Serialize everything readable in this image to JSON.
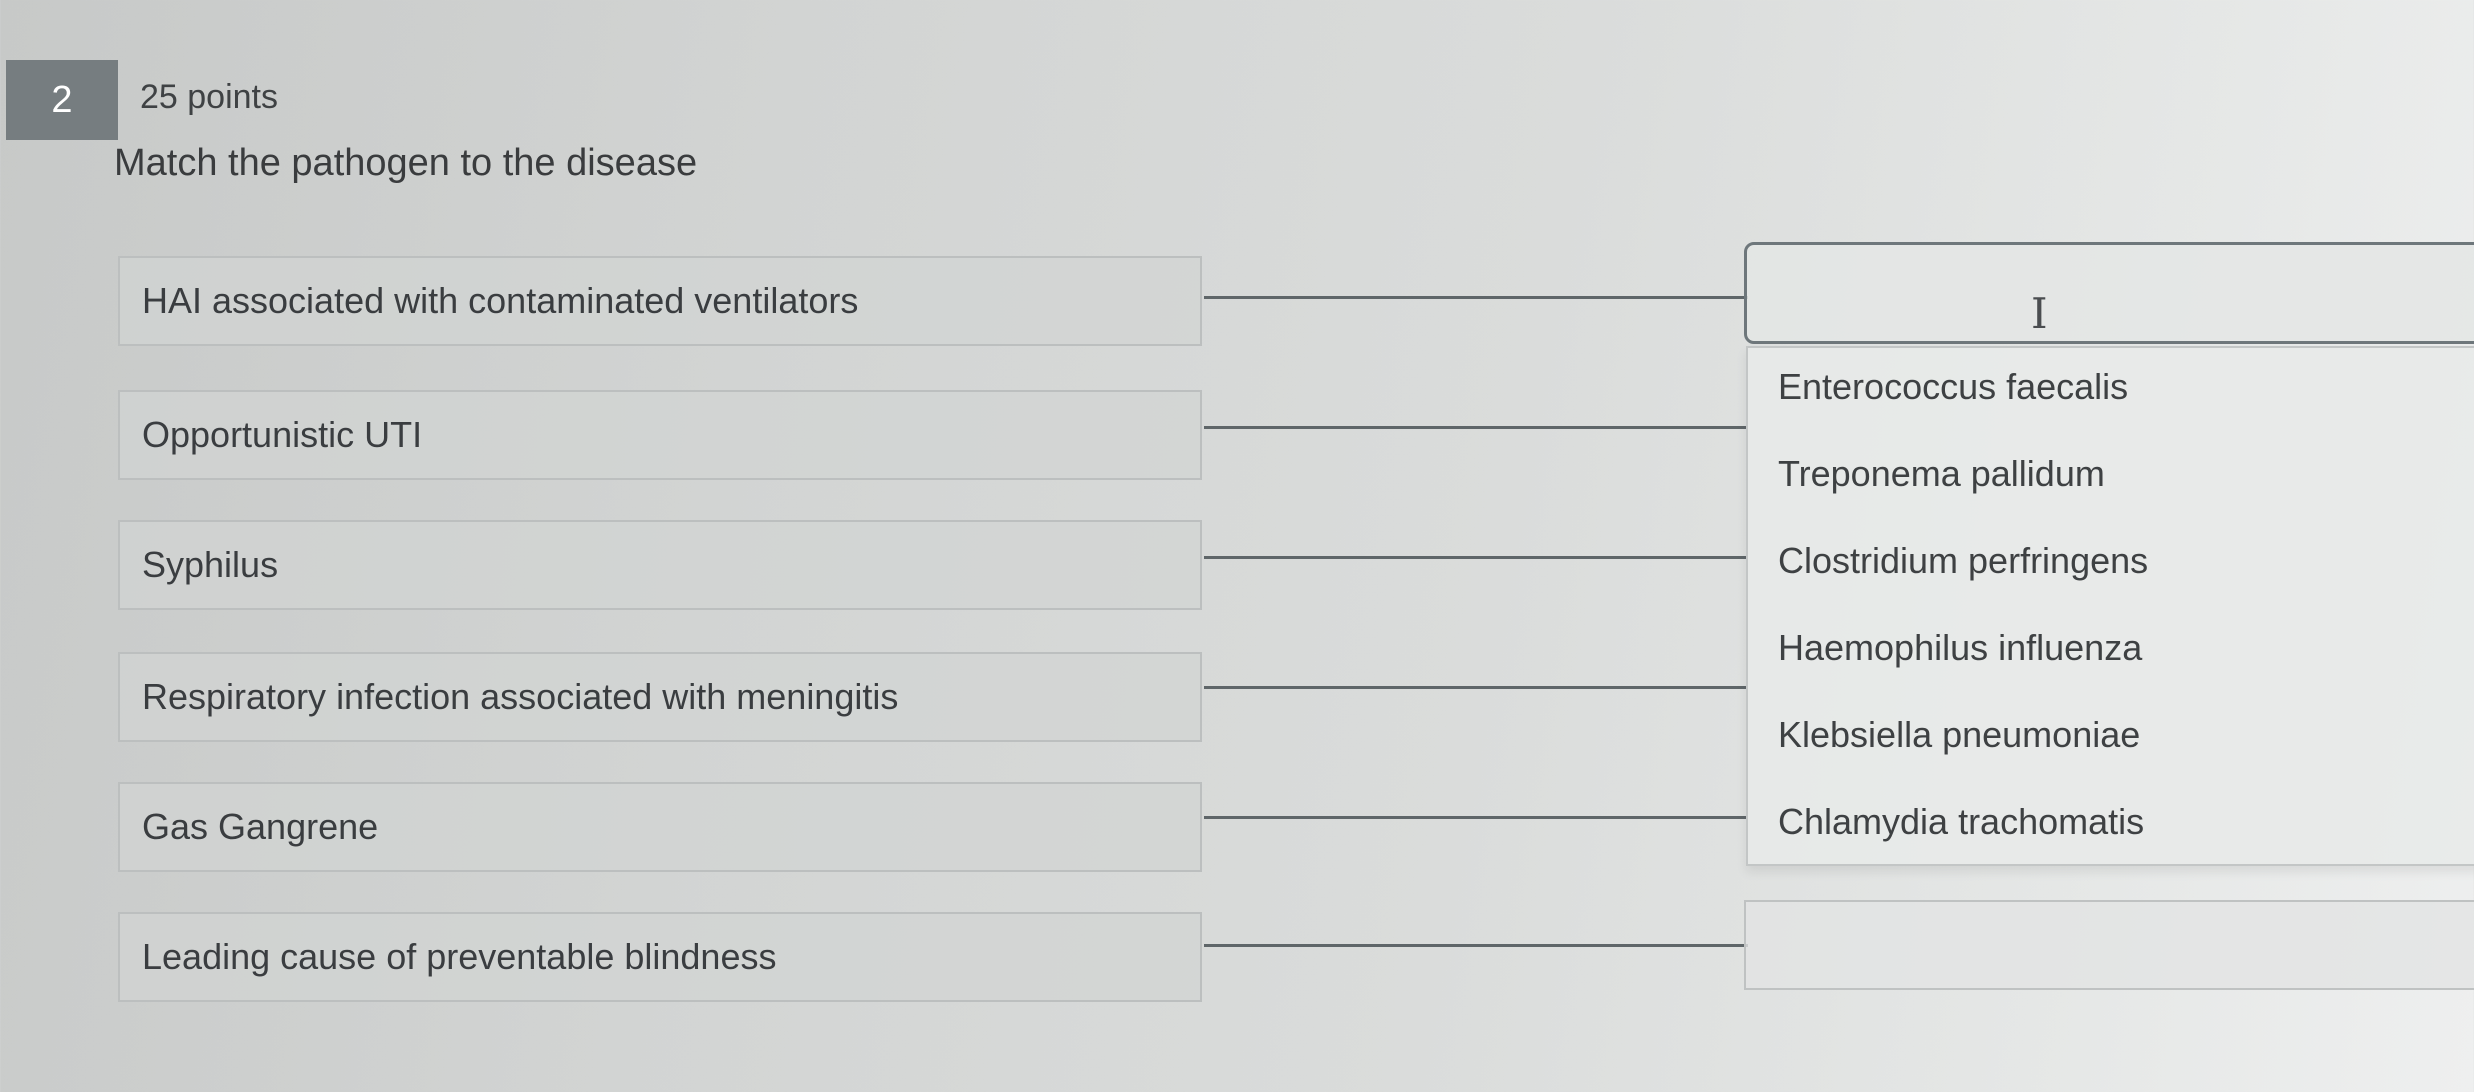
{
  "question": {
    "number": "2",
    "points": "25 points",
    "title": "Match the pathogen to the disease"
  },
  "prompts": [
    "HAI associated with contaminated ventilators",
    "Opportunistic UTI",
    "Syphilus",
    "Respiratory infection associated with meningitis",
    "Gas Gangrene",
    "Leading cause of preventable blindness"
  ],
  "dropdown": {
    "options": [
      "Enterococcus faecalis",
      "Treponema pallidum",
      "Clostridium perfringens",
      "Haemophilus influenza",
      "Klebsiella pneumoniae",
      "Chlamydia trachomatis"
    ]
  },
  "icons": {
    "cursor": "text-cursor-icon"
  },
  "colors": {
    "question_badge": "#767d80",
    "connector": "#5f6669"
  }
}
